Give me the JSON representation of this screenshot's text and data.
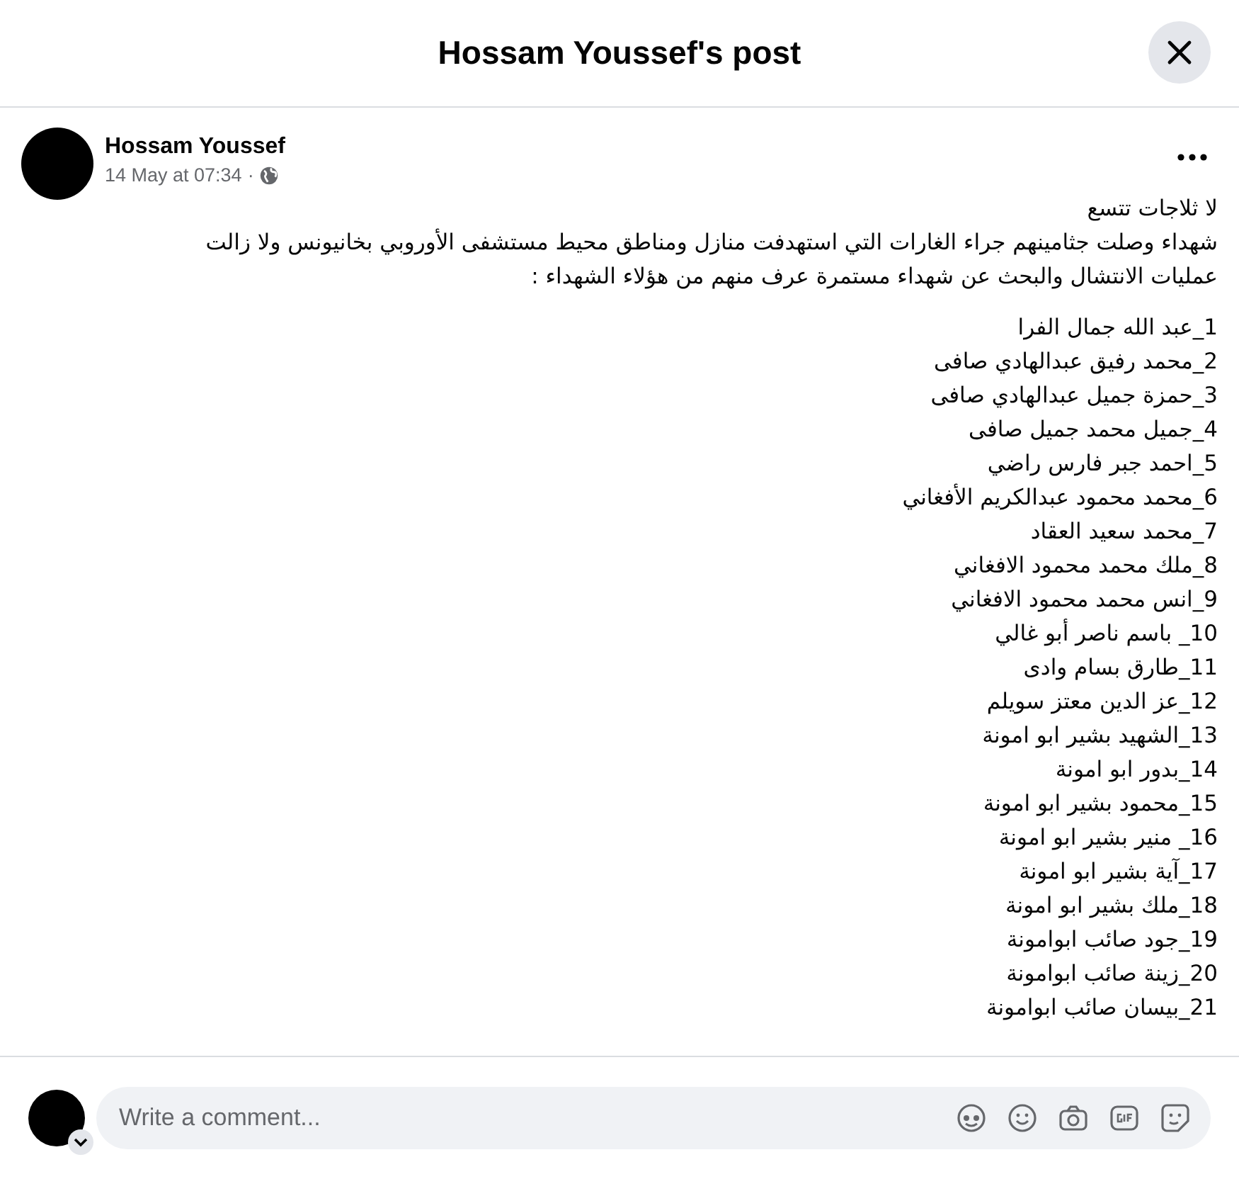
{
  "dialog": {
    "title": "Hossam Youssef's post"
  },
  "post": {
    "author": "Hossam Youssef",
    "time": "14 May at 07:34",
    "separator": "·",
    "heading": "لا ثلاجات تتسع",
    "paragraph": "شهداء وصلت جثامينهم جراء الغارات التي استهدفت منازل ومناطق محيط مستشفى الأوروبي بخانيونس ولا زالت عمليات الانتشال والبحث عن شهداء مستمرة  عرف منهم من هؤلاء الشهداء :",
    "names": [
      "1_عبد الله جمال الفرا",
      "2_محمد رفيق عبدالهادي صافى",
      "3_حمزة جميل عبدالهادي صافى",
      "4_جميل محمد جميل صافى",
      "5_احمد جبر فارس راضي",
      "6_محمد محمود عبدالكريم الأفغاني",
      "7_محمد سعيد العقاد",
      "8_ملك محمد محمود الافغاني",
      "9_انس محمد محمود الافغاني",
      "10_ باسم ناصر أبو غالي",
      "11_طارق بسام وادى",
      "12_عز الدين معتز سويلم",
      "13_الشهيد بشير  ابو امونة",
      "14_بدور ابو امونة",
      "15_محمود بشير ابو امونة",
      "16_ منير بشير ابو امونة",
      "17_آية  بشير ابو امونة",
      "18_ملك بشير ابو امونة",
      "19_جود صائب ابوامونة",
      "20_زينة صائب ابوامونة",
      "21_بيسان صائب ابوامونة"
    ]
  },
  "comment": {
    "placeholder": "Write a comment..."
  }
}
